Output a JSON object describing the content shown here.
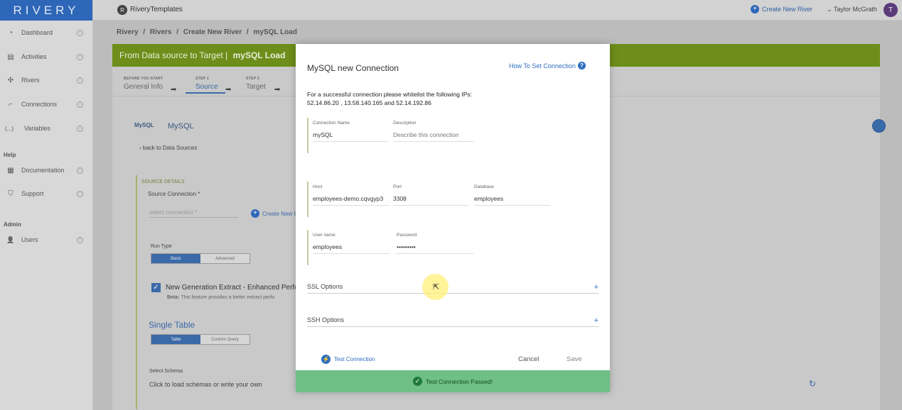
{
  "app": {
    "logo_text": "RIVERY"
  },
  "sidebar": {
    "items": [
      {
        "label": "Dashboard",
        "icon": "dashboard-icon",
        "glyph": "◔"
      },
      {
        "label": "Activities",
        "icon": "activities-icon",
        "glyph": "▤"
      },
      {
        "label": "Rivers",
        "icon": "rivers-icon",
        "glyph": "✣"
      },
      {
        "label": "Connections",
        "icon": "connections-icon",
        "glyph": "⌐"
      },
      {
        "label": "Variables",
        "icon": "variables-icon",
        "glyph": "(...)"
      }
    ],
    "help_heading": "Help",
    "help_items": [
      {
        "label": "Documentation",
        "icon": "documentation-icon",
        "glyph": "▦"
      },
      {
        "label": "Support",
        "icon": "support-icon",
        "glyph": "⛉"
      }
    ],
    "admin_heading": "Admin",
    "admin_items": [
      {
        "label": "Users",
        "icon": "users-icon",
        "glyph": "👤"
      }
    ],
    "info_glyph": "i"
  },
  "topbar": {
    "workspace_initial": "R",
    "workspace_name": "RiveryTemplates",
    "create_river_label": "Create New River",
    "user_name": "Taylor McGrath",
    "user_initial": "T"
  },
  "breadcrumb": {
    "items": [
      "Rivery",
      "/",
      "Rivers",
      "/",
      "Create New River",
      "/",
      "mySQL Load"
    ]
  },
  "header": {
    "title_prefix": "From Data source to Target |",
    "title_name": "mySQL Load"
  },
  "steps": [
    {
      "small": "BEFORE YOU START",
      "label": "General Info"
    },
    {
      "small": "STEP 1",
      "label": "Source"
    },
    {
      "small": "STEP 2",
      "label": "Target"
    }
  ],
  "source": {
    "logo_text": "MySQL",
    "title": "MySQL",
    "back_link": "back to Data Sources",
    "section_label": "SOURCE DETAILS",
    "connection_label": "Source Connection *",
    "select_placeholder": "select connection *",
    "create_new_label": "Create New C",
    "run_type_label": "Run Type",
    "run_type_options": [
      "Basic",
      "Advanced"
    ],
    "new_gen_label": "New Generation Extract - Enhanced Perfor",
    "beta_bold": "Beta:",
    "beta_text": "This feature provides a better extract perfo",
    "single_table_title": "Single Table",
    "table_options": [
      "Table",
      "Custom Query"
    ],
    "select_schema_label": "Select Schema",
    "schema_placeholder": "Click to load schemas or write your own"
  },
  "modal": {
    "title": "MySQL new Connection",
    "help_link": "How To Set Connection",
    "whitelist_line1": "For a successful connection please whitelist the following IPs:",
    "whitelist_line2": "52.14.86.20 , 13.58.140.165 and 52.14.192.86",
    "fields": {
      "connection_name": {
        "label": "Connection Name",
        "value": "mySQL"
      },
      "description": {
        "label": "Description",
        "placeholder": "Describe this connection"
      },
      "host": {
        "label": "Host",
        "value": "employees-demo.cqvgyp3"
      },
      "port": {
        "label": "Port",
        "value": "3308"
      },
      "database": {
        "label": "Database",
        "value": "employees"
      },
      "username": {
        "label": "User name",
        "value": "employees"
      },
      "password": {
        "label": "Password",
        "value": "•••••••••"
      }
    },
    "ssl_label": "SSL Options",
    "ssh_label": "SSH Options",
    "test_connection_label": "Test Connection",
    "cancel_label": "Cancel",
    "save_label": "Save",
    "toast_text": "Test Connection Passed!"
  },
  "colors": {
    "brand": "#2e67b8",
    "header_green": "#6d8e1a",
    "success": "#6fbf86",
    "link": "#2e6fc0"
  }
}
